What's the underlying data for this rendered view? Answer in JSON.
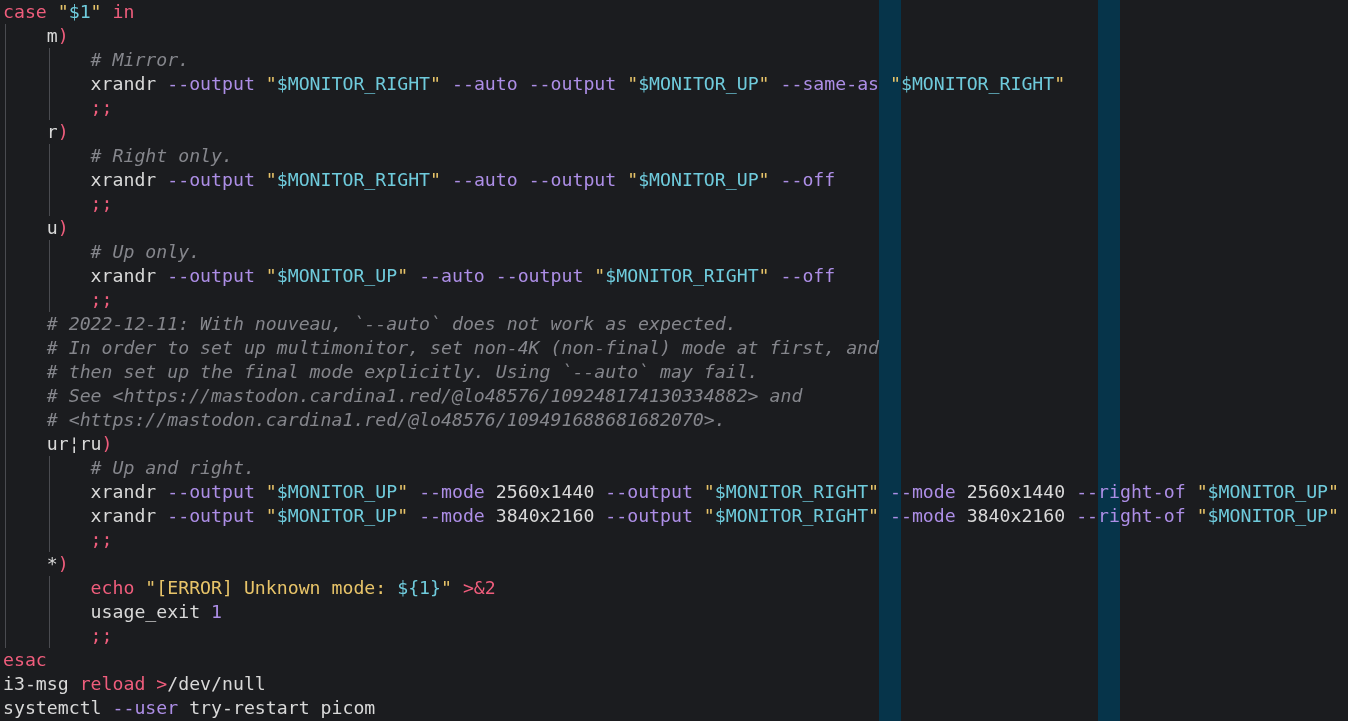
{
  "editor": {
    "lines": [
      {
        "tokens": [
          {
            "kind": "keyword",
            "text": "case "
          },
          {
            "kind": "quote",
            "text": "\""
          },
          {
            "kind": "variable",
            "text": "$1"
          },
          {
            "kind": "quote",
            "text": "\""
          },
          {
            "kind": "keyword",
            "text": " in"
          }
        ],
        "children": [
          {
            "tokens": [
              {
                "kind": "plain",
                "text": "m"
              },
              {
                "kind": "keyword",
                "text": ")"
              }
            ],
            "children": [
              {
                "tokens": [
                  {
                    "kind": "comment",
                    "text": "# Mirror."
                  }
                ]
              },
              {
                "tokens": [
                  {
                    "kind": "plain",
                    "text": "xrandr "
                  },
                  {
                    "kind": "flag",
                    "text": "--output "
                  },
                  {
                    "kind": "quote",
                    "text": "\""
                  },
                  {
                    "kind": "variable",
                    "text": "$MONITOR_RIGHT"
                  },
                  {
                    "kind": "quote",
                    "text": "\" "
                  },
                  {
                    "kind": "flag",
                    "text": "--auto --output "
                  },
                  {
                    "kind": "quote",
                    "text": "\""
                  },
                  {
                    "kind": "variable",
                    "text": "$MONITOR_UP"
                  },
                  {
                    "kind": "quote",
                    "text": "\" "
                  },
                  {
                    "kind": "flag",
                    "text": "--same-as "
                  },
                  {
                    "kind": "quote",
                    "text": "\""
                  },
                  {
                    "kind": "variable",
                    "text": "$MONITOR_RIGHT"
                  },
                  {
                    "kind": "quote",
                    "text": "\""
                  }
                ]
              },
              {
                "tokens": [
                  {
                    "kind": "keyword",
                    "text": ";;"
                  }
                ]
              }
            ]
          },
          {
            "tokens": [
              {
                "kind": "plain",
                "text": "r"
              },
              {
                "kind": "keyword",
                "text": ")"
              }
            ],
            "children": [
              {
                "tokens": [
                  {
                    "kind": "comment",
                    "text": "# Right only."
                  }
                ]
              },
              {
                "tokens": [
                  {
                    "kind": "plain",
                    "text": "xrandr "
                  },
                  {
                    "kind": "flag",
                    "text": "--output "
                  },
                  {
                    "kind": "quote",
                    "text": "\""
                  },
                  {
                    "kind": "variable",
                    "text": "$MONITOR_RIGHT"
                  },
                  {
                    "kind": "quote",
                    "text": "\" "
                  },
                  {
                    "kind": "flag",
                    "text": "--auto --output "
                  },
                  {
                    "kind": "quote",
                    "text": "\""
                  },
                  {
                    "kind": "variable",
                    "text": "$MONITOR_UP"
                  },
                  {
                    "kind": "quote",
                    "text": "\" "
                  },
                  {
                    "kind": "flag",
                    "text": "--off"
                  }
                ]
              },
              {
                "tokens": [
                  {
                    "kind": "keyword",
                    "text": ";;"
                  }
                ]
              }
            ]
          },
          {
            "tokens": [
              {
                "kind": "plain",
                "text": "u"
              },
              {
                "kind": "keyword",
                "text": ")"
              }
            ],
            "children": [
              {
                "tokens": [
                  {
                    "kind": "comment",
                    "text": "# Up only."
                  }
                ]
              },
              {
                "tokens": [
                  {
                    "kind": "plain",
                    "text": "xrandr "
                  },
                  {
                    "kind": "flag",
                    "text": "--output "
                  },
                  {
                    "kind": "quote",
                    "text": "\""
                  },
                  {
                    "kind": "variable",
                    "text": "$MONITOR_UP"
                  },
                  {
                    "kind": "quote",
                    "text": "\" "
                  },
                  {
                    "kind": "flag",
                    "text": "--auto --output "
                  },
                  {
                    "kind": "quote",
                    "text": "\""
                  },
                  {
                    "kind": "variable",
                    "text": "$MONITOR_RIGHT"
                  },
                  {
                    "kind": "quote",
                    "text": "\" "
                  },
                  {
                    "kind": "flag",
                    "text": "--off"
                  }
                ]
              },
              {
                "tokens": [
                  {
                    "kind": "keyword",
                    "text": ";;"
                  }
                ]
              }
            ]
          },
          {
            "tokens": [
              {
                "kind": "comment",
                "text": "# 2022-12-11: With nouveau, `--auto` does not work as expected."
              }
            ]
          },
          {
            "tokens": [
              {
                "kind": "comment",
                "text": "# In order to set up multimonitor, set non-4K (non-final) mode at first, and"
              }
            ]
          },
          {
            "tokens": [
              {
                "kind": "comment",
                "text": "# then set up the final mode explicitly. Using `--auto` may fail."
              }
            ]
          },
          {
            "tokens": [
              {
                "kind": "comment",
                "text": "# See <https://mastodon.cardina1.red/@lo48576/109248174130334882> and"
              }
            ]
          },
          {
            "tokens": [
              {
                "kind": "comment",
                "text": "# <https://mastodon.cardina1.red/@lo48576/109491688681682070>."
              }
            ]
          },
          {
            "tokens": [
              {
                "kind": "plain",
                "text": "ur¦ru"
              },
              {
                "kind": "keyword",
                "text": ")"
              }
            ],
            "children": [
              {
                "tokens": [
                  {
                    "kind": "comment",
                    "text": "# Up and right."
                  }
                ]
              },
              {
                "tokens": [
                  {
                    "kind": "plain",
                    "text": "xrandr "
                  },
                  {
                    "kind": "flag",
                    "text": "--output "
                  },
                  {
                    "kind": "quote",
                    "text": "\""
                  },
                  {
                    "kind": "variable",
                    "text": "$MONITOR_UP"
                  },
                  {
                    "kind": "quote",
                    "text": "\" "
                  },
                  {
                    "kind": "flag",
                    "text": "--mode "
                  },
                  {
                    "kind": "plain",
                    "text": "2560x1440 "
                  },
                  {
                    "kind": "flag",
                    "text": "--output "
                  },
                  {
                    "kind": "quote",
                    "text": "\""
                  },
                  {
                    "kind": "variable",
                    "text": "$MONITOR_RIGHT"
                  },
                  {
                    "kind": "quote",
                    "text": "\" "
                  },
                  {
                    "kind": "flag",
                    "text": "--mode "
                  },
                  {
                    "kind": "plain",
                    "text": "2560x1440 "
                  },
                  {
                    "kind": "flag",
                    "text": "--right-of "
                  },
                  {
                    "kind": "quote",
                    "text": "\""
                  },
                  {
                    "kind": "variable",
                    "text": "$MONITOR_UP"
                  },
                  {
                    "kind": "quote",
                    "text": "\""
                  }
                ]
              },
              {
                "tokens": [
                  {
                    "kind": "plain",
                    "text": "xrandr "
                  },
                  {
                    "kind": "flag",
                    "text": "--output "
                  },
                  {
                    "kind": "quote",
                    "text": "\""
                  },
                  {
                    "kind": "variable",
                    "text": "$MONITOR_UP"
                  },
                  {
                    "kind": "quote",
                    "text": "\" "
                  },
                  {
                    "kind": "flag",
                    "text": "--mode "
                  },
                  {
                    "kind": "plain",
                    "text": "3840x2160 "
                  },
                  {
                    "kind": "flag",
                    "text": "--output "
                  },
                  {
                    "kind": "quote",
                    "text": "\""
                  },
                  {
                    "kind": "variable",
                    "text": "$MONITOR_RIGHT"
                  },
                  {
                    "kind": "quote",
                    "text": "\" "
                  },
                  {
                    "kind": "flag",
                    "text": "--mode "
                  },
                  {
                    "kind": "plain",
                    "text": "3840x2160 "
                  },
                  {
                    "kind": "flag",
                    "text": "--right-of "
                  },
                  {
                    "kind": "quote",
                    "text": "\""
                  },
                  {
                    "kind": "variable",
                    "text": "$MONITOR_UP"
                  },
                  {
                    "kind": "quote",
                    "text": "\""
                  }
                ]
              },
              {
                "tokens": [
                  {
                    "kind": "keyword",
                    "text": ";;"
                  }
                ]
              }
            ]
          },
          {
            "tokens": [
              {
                "kind": "plain",
                "text": "*"
              },
              {
                "kind": "keyword",
                "text": ")"
              }
            ],
            "children": [
              {
                "tokens": [
                  {
                    "kind": "keyword",
                    "text": "echo "
                  },
                  {
                    "kind": "quote",
                    "text": "\"[ERROR] Unknown mode: "
                  },
                  {
                    "kind": "variable",
                    "text": "${1}"
                  },
                  {
                    "kind": "quote",
                    "text": "\" "
                  },
                  {
                    "kind": "keyword",
                    "text": ">&2"
                  }
                ]
              },
              {
                "tokens": [
                  {
                    "kind": "plain",
                    "text": "usage_exit "
                  },
                  {
                    "kind": "number",
                    "text": "1"
                  }
                ]
              },
              {
                "tokens": [
                  {
                    "kind": "keyword",
                    "text": ";;"
                  }
                ]
              }
            ]
          }
        ]
      },
      {
        "tokens": [
          {
            "kind": "keyword",
            "text": "esac"
          }
        ]
      },
      {
        "tokens": [
          {
            "kind": "plain",
            "text": "i3-msg "
          },
          {
            "kind": "keyword",
            "text": "reload >"
          },
          {
            "kind": "plain",
            "text": "/dev/null"
          }
        ]
      },
      {
        "tokens": [
          {
            "kind": "plain",
            "text": "systemctl "
          },
          {
            "kind": "flag",
            "text": "--user "
          },
          {
            "kind": "plain",
            "text": "try-restart picom"
          }
        ]
      }
    ]
  }
}
